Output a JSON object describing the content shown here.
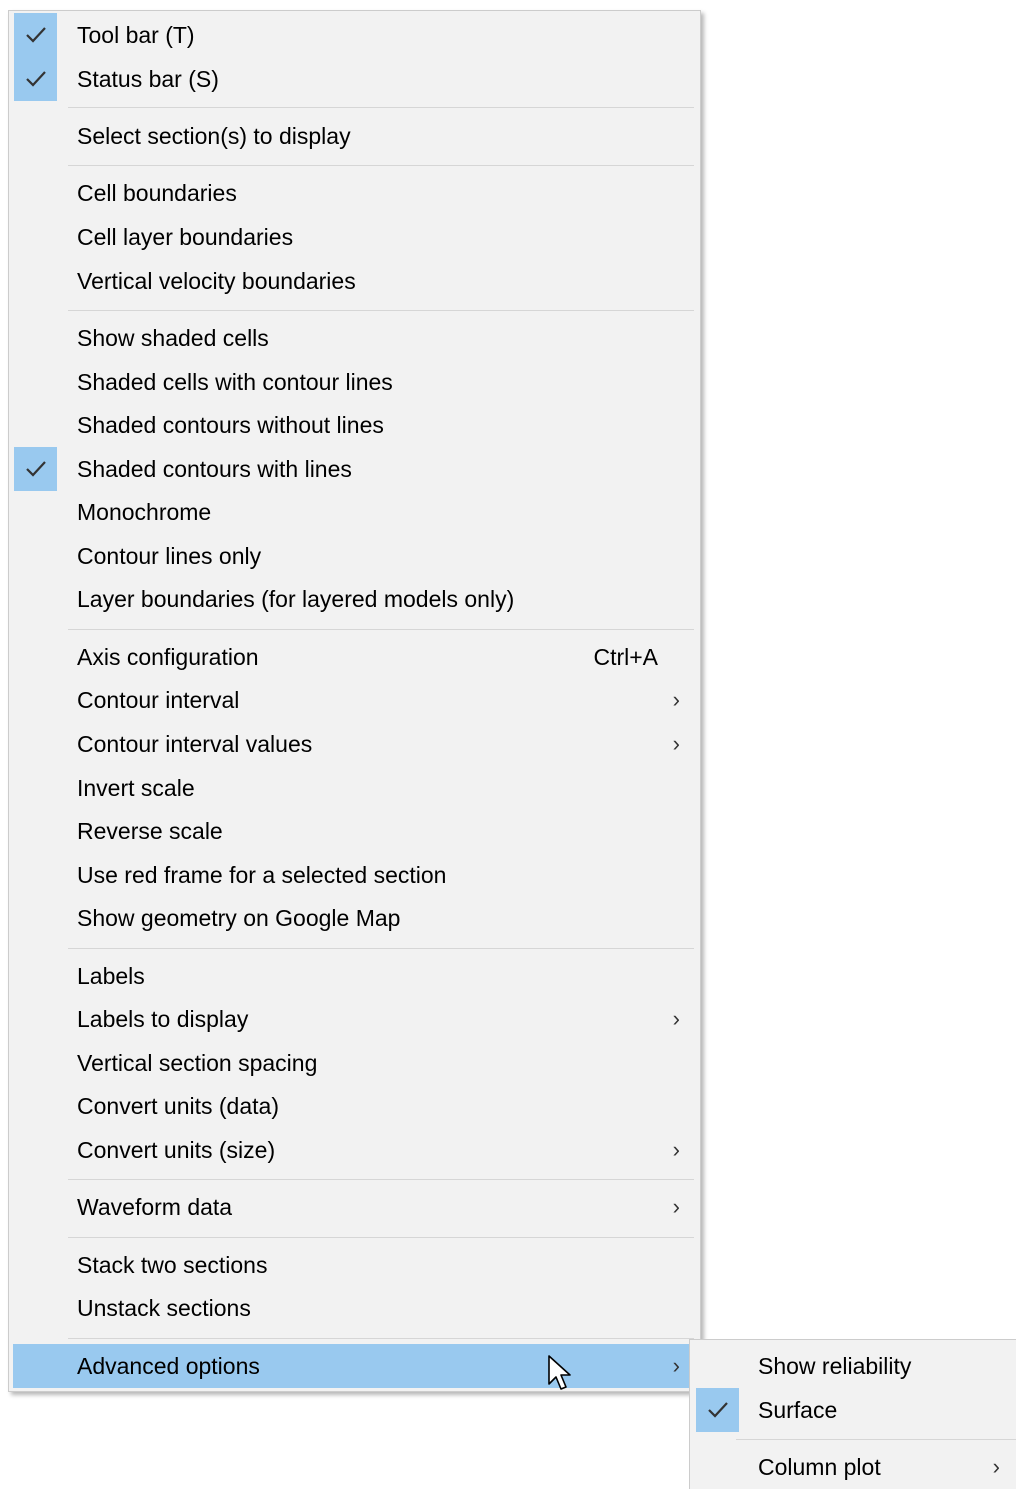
{
  "menu": {
    "items": [
      {
        "label": "Tool bar (T)",
        "checked": true
      },
      {
        "label": "Status bar (S)",
        "checked": true
      },
      {
        "label": "Select section(s) to display"
      },
      {
        "label": "Cell boundaries"
      },
      {
        "label": "Cell layer boundaries"
      },
      {
        "label": "Vertical velocity boundaries"
      },
      {
        "label": "Show shaded cells"
      },
      {
        "label": "Shaded cells with contour lines"
      },
      {
        "label": "Shaded contours without lines"
      },
      {
        "label": "Shaded contours with lines",
        "checked": true
      },
      {
        "label": "Monochrome"
      },
      {
        "label": "Contour lines only"
      },
      {
        "label": "Layer boundaries (for layered models only)"
      },
      {
        "label": "Axis configuration",
        "shortcut": "Ctrl+A"
      },
      {
        "label": "Contour interval",
        "submenu": true
      },
      {
        "label": "Contour interval values",
        "submenu": true
      },
      {
        "label": "Invert scale"
      },
      {
        "label": "Reverse scale"
      },
      {
        "label": "Use red frame for a selected section"
      },
      {
        "label": "Show geometry on Google Map"
      },
      {
        "label": "Labels"
      },
      {
        "label": "Labels to display",
        "submenu": true
      },
      {
        "label": "Vertical section spacing"
      },
      {
        "label": "Convert units (data)"
      },
      {
        "label": "Convert units (size)",
        "submenu": true
      },
      {
        "label": "Waveform data",
        "submenu": true
      },
      {
        "label": "Stack two sections"
      },
      {
        "label": "Unstack sections"
      },
      {
        "label": "Advanced options",
        "submenu": true,
        "highlighted": true
      }
    ]
  },
  "submenu": {
    "parent": "Advanced options",
    "items": [
      {
        "label": "Show reliability"
      },
      {
        "label": "Surface",
        "checked": true
      },
      {
        "label": "Column plot",
        "submenu": true
      }
    ]
  },
  "colors": {
    "menu_background": "#f2f2f2",
    "highlight": "#99c9ef",
    "separator": "#d6d6d6",
    "text": "#000000"
  },
  "icons": {
    "check": "check-icon",
    "submenu_arrow": "chevron-right-icon",
    "pointer": "mouse-pointer-icon"
  }
}
